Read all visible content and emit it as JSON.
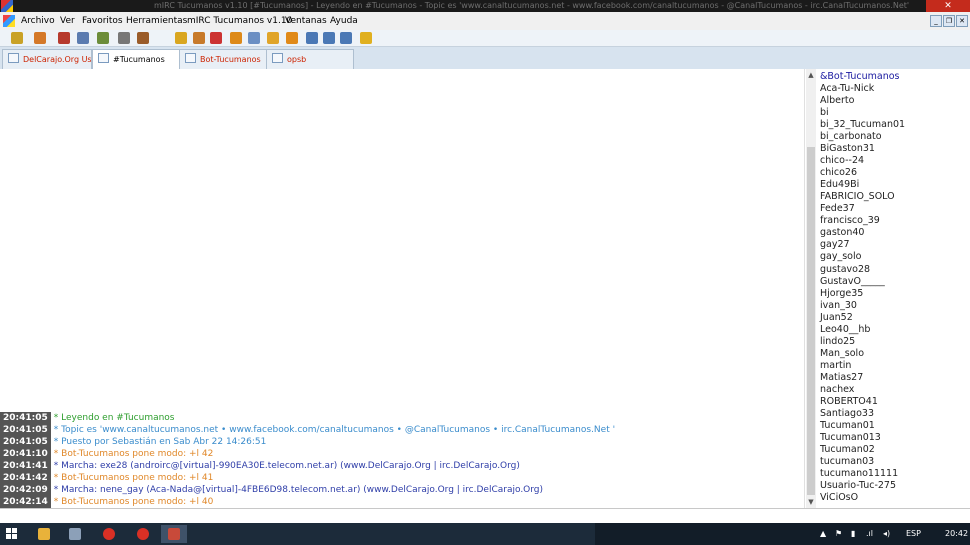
{
  "window": {
    "title": "mIRC Tucumanos v1.10 [#Tucumanos] - Leyendo en #Tucumanos - Topic es 'www.canaltucumanos.net - www.facebook.com/canaltucumanos - @CanalTucumanos - irc.CanalTucumanos.Net'",
    "close_label": "✕"
  },
  "menu": [
    "Archivo",
    "Ver",
    "Favoritos",
    "Herramientas",
    "mIRC Tucumanos v1.10",
    "Ventanas",
    "Ayuda"
  ],
  "window_controls": [
    "_",
    "❐",
    "✕"
  ],
  "toolbar": {
    "icons": [
      "wand-icon",
      "home-icon",
      "heart-icon",
      "sound-icon",
      "notepad-icon",
      "settings-icon",
      "books-icon",
      "folder-lock-icon",
      "users-icon",
      "user-add-icon",
      "people-icon",
      "search-user-icon",
      "send-icon",
      "receive-icon",
      "tile-horizontal-icon",
      "tile-vertical-icon",
      "cascade-icon",
      "help-icon"
    ],
    "colors": [
      "#c9a227",
      "#d4792a",
      "#b63a2f",
      "#5a7bb0",
      "#6c8d3a",
      "#777777",
      "#9a5c2a",
      "#d9a620",
      "#c77a2b",
      "#c33",
      "#dd8a1a",
      "#6a8fc4",
      "#e0a52a",
      "#e08a1a",
      "#4a78b5",
      "#4a78b5",
      "#4a78b5",
      "#e0b020"
    ]
  },
  "tabs": [
    {
      "label": "DelCarajo.Org Usu..."
    },
    {
      "label": "#Tucumanos"
    },
    {
      "label": "Bot-Tucumanos"
    },
    {
      "label": "opsb"
    }
  ],
  "messages": [
    {
      "time": "20:41:05",
      "color": "#2e9e2e",
      "text": "* Leyendo en #Tucumanos"
    },
    {
      "time": "20:41:05",
      "color": "#3a8ccc",
      "text": "* Topic es 'www.canaltucumanos.net • www.facebook.com/canaltucumanos • @CanalTucumanos • irc.CanalTucumanos.Net '"
    },
    {
      "time": "20:41:05",
      "color": "#3a8ccc",
      "text": "* Puesto por Sebastián en Sab Abr 22 14:26:51"
    },
    {
      "time": "20:41:10",
      "color": "#e0882a",
      "text": "* Bot-Tucumanos pone modo: +l 42"
    },
    {
      "time": "20:41:41",
      "color": "#2f3ea8",
      "text": "* Marcha: exe28 (androirc@[virtual]-990EA30E.telecom.net.ar) (www.DelCarajo.Org | irc.DelCarajo.Org)"
    },
    {
      "time": "20:41:42",
      "color": "#e0882a",
      "text": "* Bot-Tucumanos pone modo: +l 41"
    },
    {
      "time": "20:42:09",
      "color": "#2f3ea8",
      "text": "* Marcha: nene_gay (Aca-Nada@[virtual]-4FBE6D98.telecom.net.ar) (www.DelCarajo.Org | irc.DelCarajo.Org)"
    },
    {
      "time": "20:42:14",
      "color": "#e0882a",
      "text": "* Bot-Tucumanos pone modo: +l 40"
    }
  ],
  "nicklist": [
    "&Bot-Tucumanos",
    "Aca-Tu-Nick",
    "Alberto",
    "bi",
    "bi_32_Tucuman01",
    "bi_carbonato",
    "BiGaston31",
    "chico--24",
    "chico26",
    "Edu49Bi",
    "FABRICIO_SOLO",
    "Fede37",
    "francisco_39",
    "gaston40",
    "gay27",
    "gay_solo",
    "gustavo28",
    "GustavO_____",
    "Hjorge35",
    "ivan_30",
    "Juan52",
    "Leo40__hb",
    "lindo25",
    "Man_solo",
    "martin",
    "Matias27",
    "nachex",
    "ROBERTO41",
    "Santiago33",
    "Tucuman01",
    "Tucuman013",
    "Tucuman02",
    "tucuman03",
    "tucumano11111",
    "Usuario-Tuc-275",
    "ViCiOsO"
  ],
  "input": {
    "value": ""
  },
  "taskbar": {
    "apps": [
      {
        "name": "file-explorer-icon",
        "color": "#e8b23a"
      },
      {
        "name": "notepad-app-icon",
        "color": "#8ca0b8"
      },
      {
        "name": "chrome-icon",
        "color": "#d93025"
      },
      {
        "name": "chrome-icon",
        "color": "#d93025"
      },
      {
        "name": "mirc-icon",
        "color": "#c84a3a"
      }
    ],
    "tray": {
      "language": "ESP",
      "time": "20:42"
    }
  }
}
